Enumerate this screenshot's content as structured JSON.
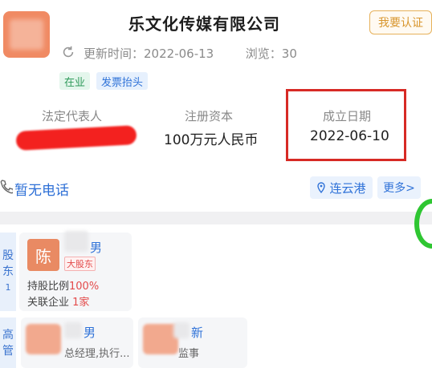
{
  "company": {
    "name": "乐文化传媒有限公司",
    "certify_label": "我要认证",
    "updated_label": "更新时间：",
    "updated_date": "2022-06-13",
    "views_label": "浏览：",
    "views": "30",
    "tags": [
      "在业",
      "发票抬头"
    ]
  },
  "info": {
    "legal_rep_label": "法定代表人",
    "capital_label": "注册资本",
    "capital_value": "100万元人民币",
    "founded_label": "成立日期",
    "founded_value": "2022-06-10"
  },
  "contact": {
    "phone": "暂无电话",
    "location": "连云港",
    "more": "更多>"
  },
  "shareholders": {
    "section_label": [
      "股",
      "东",
      "1"
    ],
    "items": [
      {
        "avatar_char": "陈",
        "name_suffix": "男",
        "badge": "大股东",
        "ratio_label": "持股比例",
        "ratio_value": "100%",
        "related_label": "关联企业",
        "related_value": "1家"
      }
    ]
  },
  "management": {
    "section_label": [
      "高",
      "管"
    ],
    "items": [
      {
        "name_suffix": "男",
        "role": "总经理,执行..."
      },
      {
        "name_suffix": "新",
        "role": "监事"
      }
    ]
  }
}
